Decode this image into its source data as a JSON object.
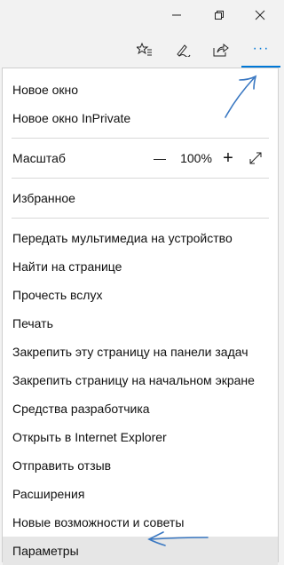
{
  "window": {
    "controls": [
      "minimize",
      "restore",
      "close"
    ]
  },
  "toolbar": {
    "buttons": [
      {
        "icon": "favorites-star-list-icon"
      },
      {
        "icon": "pen-icon"
      },
      {
        "icon": "share-icon"
      },
      {
        "icon": "more-dots-icon",
        "label": "···"
      }
    ],
    "accent": "#0078d7"
  },
  "menu": {
    "group1": [
      "Новое окно",
      "Новое окно InPrivate"
    ],
    "zoom": {
      "label": "Масштаб",
      "minus": "—",
      "value": "100%",
      "plus": "+"
    },
    "group3": [
      "Избранное"
    ],
    "group4": [
      "Передать мультимедиа на устройство",
      "Найти на странице",
      "Прочесть вслух",
      "Печать",
      "Закрепить эту страницу на панели задач",
      "Закрепить страницу на начальном экране",
      "Средства разработчика",
      "Открыть в Internet Explorer",
      "Отправить отзыв",
      "Расширения",
      "Новые возможности и советы",
      "Параметры"
    ],
    "highlighted": "Параметры"
  },
  "annotation_color": "#3a78c2"
}
